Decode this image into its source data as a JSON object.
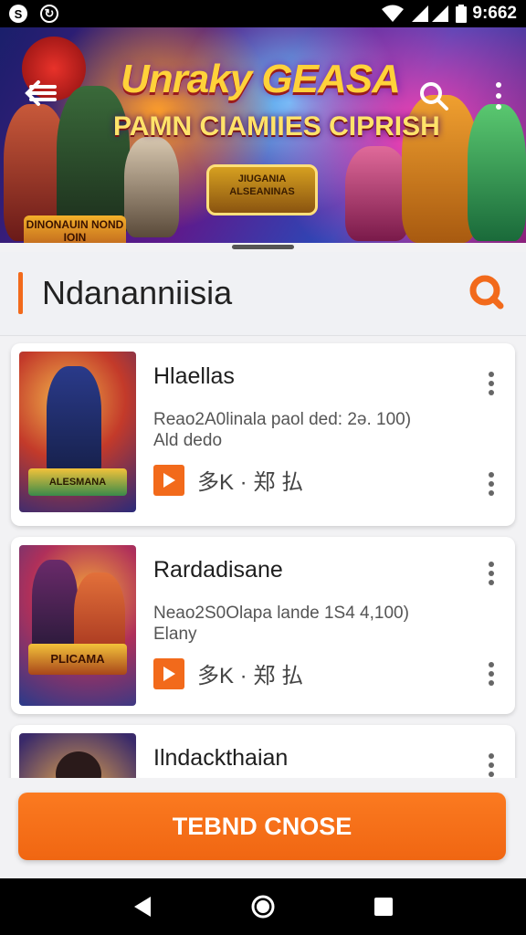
{
  "status_bar": {
    "time": "9:662",
    "left_icons": [
      "notification-icon",
      "sync-icon"
    ],
    "right_icons": [
      "wifi-icon",
      "signal-icon",
      "battery-icon"
    ]
  },
  "banner": {
    "title": "Unraky GEASA",
    "subtitle": "PAMN CIAMIIES CIPRISH",
    "badge_text": "JIUGANIA ALSEANINAS",
    "logo_text": "DINONAUIN NOND IOIN",
    "icons": [
      "back-arrow-icon",
      "search-icon",
      "more-vertical-icon"
    ]
  },
  "section": {
    "title": "Ndananniisia",
    "icon": "search-icon",
    "accent_color": "#f26a1b"
  },
  "items": [
    {
      "title": "Hlaellas",
      "desc_line1": "Reao2A0linala paol ded: 2ə. 100)",
      "desc_line2": "Ald dedo",
      "meta": "多K · 郑 払",
      "thumb_label": "ALESMANA"
    },
    {
      "title": "Rardadisane",
      "desc_line1": "Neao2S0Olapa lande 1S4  4,100)",
      "desc_line2": "Elany",
      "meta": "多K · 郑 払",
      "thumb_label": "PLICAMA"
    },
    {
      "title": "Ilndackthaian"
    }
  ],
  "cta": {
    "label": "TEBND CNOSE"
  },
  "nav": {
    "icons": [
      "back-icon",
      "home-icon",
      "recents-icon"
    ]
  }
}
